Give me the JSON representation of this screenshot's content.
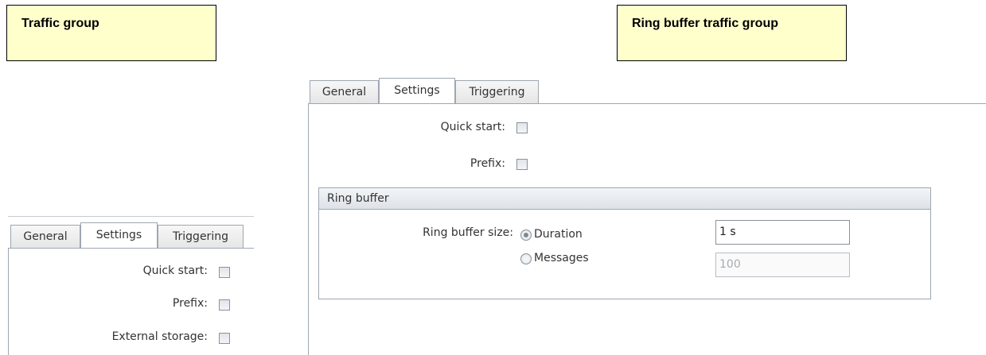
{
  "callouts": {
    "left": "Traffic group",
    "right": "Ring buffer traffic group"
  },
  "ring_buffer_panel": {
    "tabs": [
      {
        "label": "General",
        "active": false
      },
      {
        "label": "Settings",
        "active": true
      },
      {
        "label": "Triggering",
        "active": false
      }
    ],
    "quick_start_label": "Quick start:",
    "prefix_label": "Prefix:",
    "group_title": "Ring buffer",
    "ring_buffer_size_label": "Ring buffer size:",
    "options": [
      {
        "label": "Duration",
        "selected": true
      },
      {
        "label": "Messages",
        "selected": false
      }
    ],
    "duration_value": "1 s",
    "messages_value": "100"
  },
  "traffic_panel": {
    "tabs": [
      {
        "label": "General",
        "active": false
      },
      {
        "label": "Settings",
        "active": true
      },
      {
        "label": "Triggering",
        "active": false
      }
    ],
    "quick_start_label": "Quick start:",
    "prefix_label": "Prefix:",
    "external_storage_label": "External storage:"
  },
  "colors": {
    "callout_background": "#ffffcc",
    "border": "#9ea7b1"
  }
}
